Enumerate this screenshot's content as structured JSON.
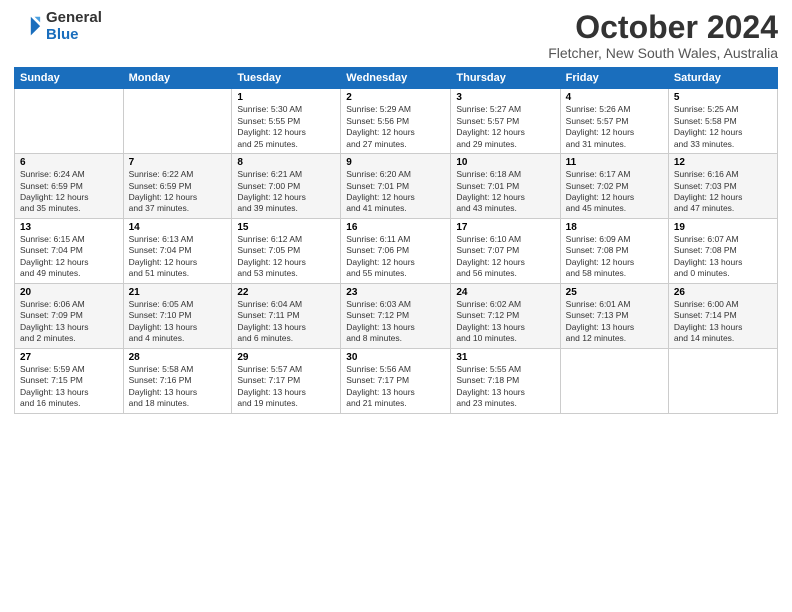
{
  "logo": {
    "general": "General",
    "blue": "Blue"
  },
  "header": {
    "title": "October 2024",
    "subtitle": "Fletcher, New South Wales, Australia"
  },
  "weekdays": [
    "Sunday",
    "Monday",
    "Tuesday",
    "Wednesday",
    "Thursday",
    "Friday",
    "Saturday"
  ],
  "weeks": [
    [
      {
        "day": "",
        "info": ""
      },
      {
        "day": "",
        "info": ""
      },
      {
        "day": "1",
        "info": "Sunrise: 5:30 AM\nSunset: 5:55 PM\nDaylight: 12 hours\nand 25 minutes."
      },
      {
        "day": "2",
        "info": "Sunrise: 5:29 AM\nSunset: 5:56 PM\nDaylight: 12 hours\nand 27 minutes."
      },
      {
        "day": "3",
        "info": "Sunrise: 5:27 AM\nSunset: 5:57 PM\nDaylight: 12 hours\nand 29 minutes."
      },
      {
        "day": "4",
        "info": "Sunrise: 5:26 AM\nSunset: 5:57 PM\nDaylight: 12 hours\nand 31 minutes."
      },
      {
        "day": "5",
        "info": "Sunrise: 5:25 AM\nSunset: 5:58 PM\nDaylight: 12 hours\nand 33 minutes."
      }
    ],
    [
      {
        "day": "6",
        "info": "Sunrise: 6:24 AM\nSunset: 6:59 PM\nDaylight: 12 hours\nand 35 minutes."
      },
      {
        "day": "7",
        "info": "Sunrise: 6:22 AM\nSunset: 6:59 PM\nDaylight: 12 hours\nand 37 minutes."
      },
      {
        "day": "8",
        "info": "Sunrise: 6:21 AM\nSunset: 7:00 PM\nDaylight: 12 hours\nand 39 minutes."
      },
      {
        "day": "9",
        "info": "Sunrise: 6:20 AM\nSunset: 7:01 PM\nDaylight: 12 hours\nand 41 minutes."
      },
      {
        "day": "10",
        "info": "Sunrise: 6:18 AM\nSunset: 7:01 PM\nDaylight: 12 hours\nand 43 minutes."
      },
      {
        "day": "11",
        "info": "Sunrise: 6:17 AM\nSunset: 7:02 PM\nDaylight: 12 hours\nand 45 minutes."
      },
      {
        "day": "12",
        "info": "Sunrise: 6:16 AM\nSunset: 7:03 PM\nDaylight: 12 hours\nand 47 minutes."
      }
    ],
    [
      {
        "day": "13",
        "info": "Sunrise: 6:15 AM\nSunset: 7:04 PM\nDaylight: 12 hours\nand 49 minutes."
      },
      {
        "day": "14",
        "info": "Sunrise: 6:13 AM\nSunset: 7:04 PM\nDaylight: 12 hours\nand 51 minutes."
      },
      {
        "day": "15",
        "info": "Sunrise: 6:12 AM\nSunset: 7:05 PM\nDaylight: 12 hours\nand 53 minutes."
      },
      {
        "day": "16",
        "info": "Sunrise: 6:11 AM\nSunset: 7:06 PM\nDaylight: 12 hours\nand 55 minutes."
      },
      {
        "day": "17",
        "info": "Sunrise: 6:10 AM\nSunset: 7:07 PM\nDaylight: 12 hours\nand 56 minutes."
      },
      {
        "day": "18",
        "info": "Sunrise: 6:09 AM\nSunset: 7:08 PM\nDaylight: 12 hours\nand 58 minutes."
      },
      {
        "day": "19",
        "info": "Sunrise: 6:07 AM\nSunset: 7:08 PM\nDaylight: 13 hours\nand 0 minutes."
      }
    ],
    [
      {
        "day": "20",
        "info": "Sunrise: 6:06 AM\nSunset: 7:09 PM\nDaylight: 13 hours\nand 2 minutes."
      },
      {
        "day": "21",
        "info": "Sunrise: 6:05 AM\nSunset: 7:10 PM\nDaylight: 13 hours\nand 4 minutes."
      },
      {
        "day": "22",
        "info": "Sunrise: 6:04 AM\nSunset: 7:11 PM\nDaylight: 13 hours\nand 6 minutes."
      },
      {
        "day": "23",
        "info": "Sunrise: 6:03 AM\nSunset: 7:12 PM\nDaylight: 13 hours\nand 8 minutes."
      },
      {
        "day": "24",
        "info": "Sunrise: 6:02 AM\nSunset: 7:12 PM\nDaylight: 13 hours\nand 10 minutes."
      },
      {
        "day": "25",
        "info": "Sunrise: 6:01 AM\nSunset: 7:13 PM\nDaylight: 13 hours\nand 12 minutes."
      },
      {
        "day": "26",
        "info": "Sunrise: 6:00 AM\nSunset: 7:14 PM\nDaylight: 13 hours\nand 14 minutes."
      }
    ],
    [
      {
        "day": "27",
        "info": "Sunrise: 5:59 AM\nSunset: 7:15 PM\nDaylight: 13 hours\nand 16 minutes."
      },
      {
        "day": "28",
        "info": "Sunrise: 5:58 AM\nSunset: 7:16 PM\nDaylight: 13 hours\nand 18 minutes."
      },
      {
        "day": "29",
        "info": "Sunrise: 5:57 AM\nSunset: 7:17 PM\nDaylight: 13 hours\nand 19 minutes."
      },
      {
        "day": "30",
        "info": "Sunrise: 5:56 AM\nSunset: 7:17 PM\nDaylight: 13 hours\nand 21 minutes."
      },
      {
        "day": "31",
        "info": "Sunrise: 5:55 AM\nSunset: 7:18 PM\nDaylight: 13 hours\nand 23 minutes."
      },
      {
        "day": "",
        "info": ""
      },
      {
        "day": "",
        "info": ""
      }
    ]
  ]
}
